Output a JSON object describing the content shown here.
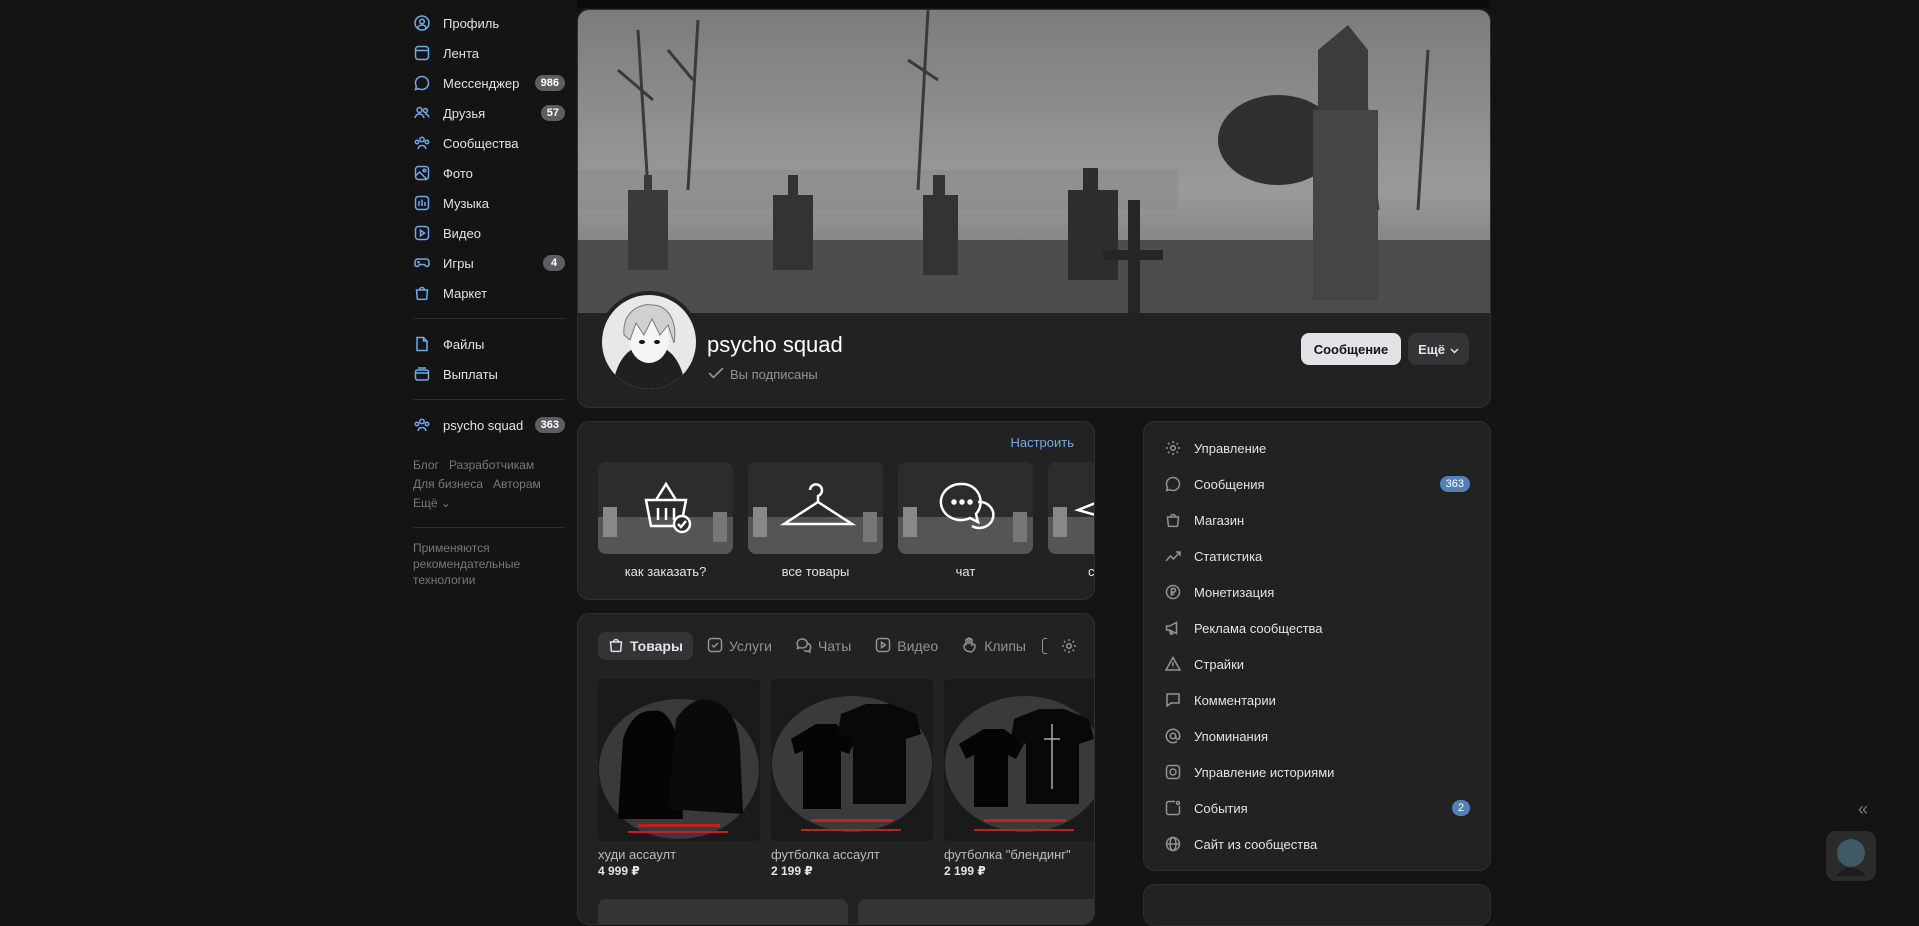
{
  "nav": {
    "items": [
      {
        "label": "Профиль",
        "icon": "user-circle-icon",
        "badge": ""
      },
      {
        "label": "Лента",
        "icon": "newsfeed-icon",
        "badge": ""
      },
      {
        "label": "Мессенджер",
        "icon": "message-icon",
        "badge": "986"
      },
      {
        "label": "Друзья",
        "icon": "users-icon",
        "badge": "57"
      },
      {
        "label": "Сообщества",
        "icon": "community-icon",
        "badge": ""
      },
      {
        "label": "Фото",
        "icon": "photo-icon",
        "badge": ""
      },
      {
        "label": "Музыка",
        "icon": "music-icon",
        "badge": ""
      },
      {
        "label": "Видео",
        "icon": "video-icon",
        "badge": ""
      },
      {
        "label": "Игры",
        "icon": "gamepad-icon",
        "badge": "4"
      },
      {
        "label": "Маркет",
        "icon": "bag-icon",
        "badge": ""
      }
    ],
    "secondary": [
      {
        "label": "Файлы",
        "icon": "file-icon"
      },
      {
        "label": "Выплаты",
        "icon": "payments-icon"
      }
    ],
    "group": {
      "label": "psycho squad",
      "badge": "363"
    },
    "footer": {
      "blog": "Блог",
      "developers": "Разработчикам",
      "business": "Для бизнеса",
      "authors": "Авторам",
      "more": "Ещё"
    },
    "note": "Применяются рекомендательные технологии"
  },
  "group": {
    "name": "psycho squad",
    "subscribed": "Вы подписаны",
    "message_button": "Сообщение",
    "more_button": "Ещё"
  },
  "links": {
    "configure": "Настроить",
    "tiles": [
      {
        "label": "как заказать?",
        "icon": "basket-check-icon"
      },
      {
        "label": "все товары",
        "icon": "hanger-icon"
      },
      {
        "label": "чат",
        "icon": "chat-bubbles-icon"
      },
      {
        "label": "соц се",
        "icon": "paper-plane-icon"
      }
    ]
  },
  "shop": {
    "tabs": [
      {
        "label": "Товары",
        "icon": "bag-icon"
      },
      {
        "label": "Услуги",
        "icon": "check-square-icon"
      },
      {
        "label": "Чаты",
        "icon": "chats-icon"
      },
      {
        "label": "Видео",
        "icon": "video-icon"
      },
      {
        "label": "Клипы",
        "icon": "clips-icon"
      }
    ],
    "products": [
      {
        "title": "худи ассаулт",
        "price": "4 999 ₽"
      },
      {
        "title": "футболка ассаулт",
        "price": "2 199 ₽"
      },
      {
        "title": "футболка \"блендинг\"",
        "price": "2 199 ₽"
      }
    ]
  },
  "admin": {
    "items": [
      {
        "label": "Управление",
        "icon": "gear-icon",
        "badge": ""
      },
      {
        "label": "Сообщения",
        "icon": "message-icon",
        "badge": "363"
      },
      {
        "label": "Магазин",
        "icon": "bag-icon",
        "badge": ""
      },
      {
        "label": "Статистика",
        "icon": "chart-line-icon",
        "badge": ""
      },
      {
        "label": "Монетизация",
        "icon": "ruble-icon",
        "badge": ""
      },
      {
        "label": "Реклама сообщества",
        "icon": "megaphone-icon",
        "badge": ""
      },
      {
        "label": "Страйки",
        "icon": "warning-icon",
        "badge": ""
      },
      {
        "label": "Комментарии",
        "icon": "comment-icon",
        "badge": ""
      },
      {
        "label": "Упоминания",
        "icon": "at-icon",
        "badge": ""
      },
      {
        "label": "Управление историями",
        "icon": "stories-icon",
        "badge": ""
      },
      {
        "label": "События",
        "icon": "event-icon",
        "badge": "2"
      },
      {
        "label": "Сайт из сообщества",
        "icon": "globe-icon",
        "badge": ""
      }
    ]
  },
  "colors": {
    "accent": "#71aaeb",
    "background": "#141414",
    "card": "#222222",
    "badge_blue": "#5181b8"
  }
}
